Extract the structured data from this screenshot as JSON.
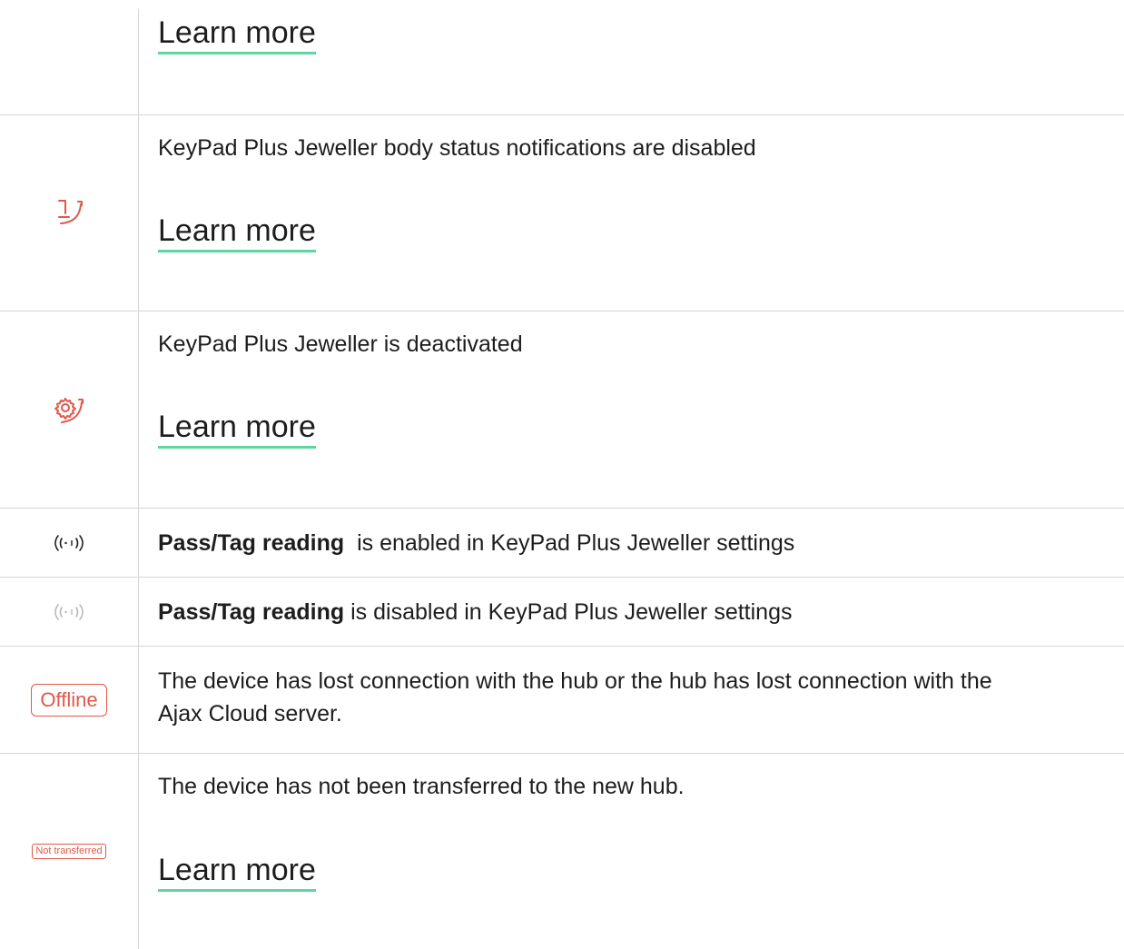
{
  "rows": [
    {
      "learn_more": "Learn more"
    },
    {
      "icon": "body-status-disabled-icon",
      "text": "KeyPad Plus Jeweller body status notifications are disabled",
      "learn_more": "Learn more"
    },
    {
      "icon": "gear-deactivated-icon",
      "text": "KeyPad Plus Jeweller is deactivated",
      "learn_more": "Learn more"
    },
    {
      "icon": "pass-tag-enabled-icon",
      "bold": "Pass/Tag reading",
      "text": "  is enabled in KeyPad Plus Jeweller settings"
    },
    {
      "icon": "pass-tag-disabled-icon",
      "bold": "Pass/Tag reading",
      "text": " is disabled in KeyPad Plus Jeweller settings"
    },
    {
      "badge": "Offline",
      "text_line1": "The device has lost connection with the hub or the hub has lost connection with the",
      "text_line2": "Ajax Cloud server."
    },
    {
      "badge": "Not transferred",
      "text": "The device has not been transferred to the new hub.",
      "learn_more": "Learn more"
    }
  ],
  "colors": {
    "accent_red": "#e0584a",
    "link_underline": "#5fd6a2",
    "divider": "#d6d6d6"
  }
}
